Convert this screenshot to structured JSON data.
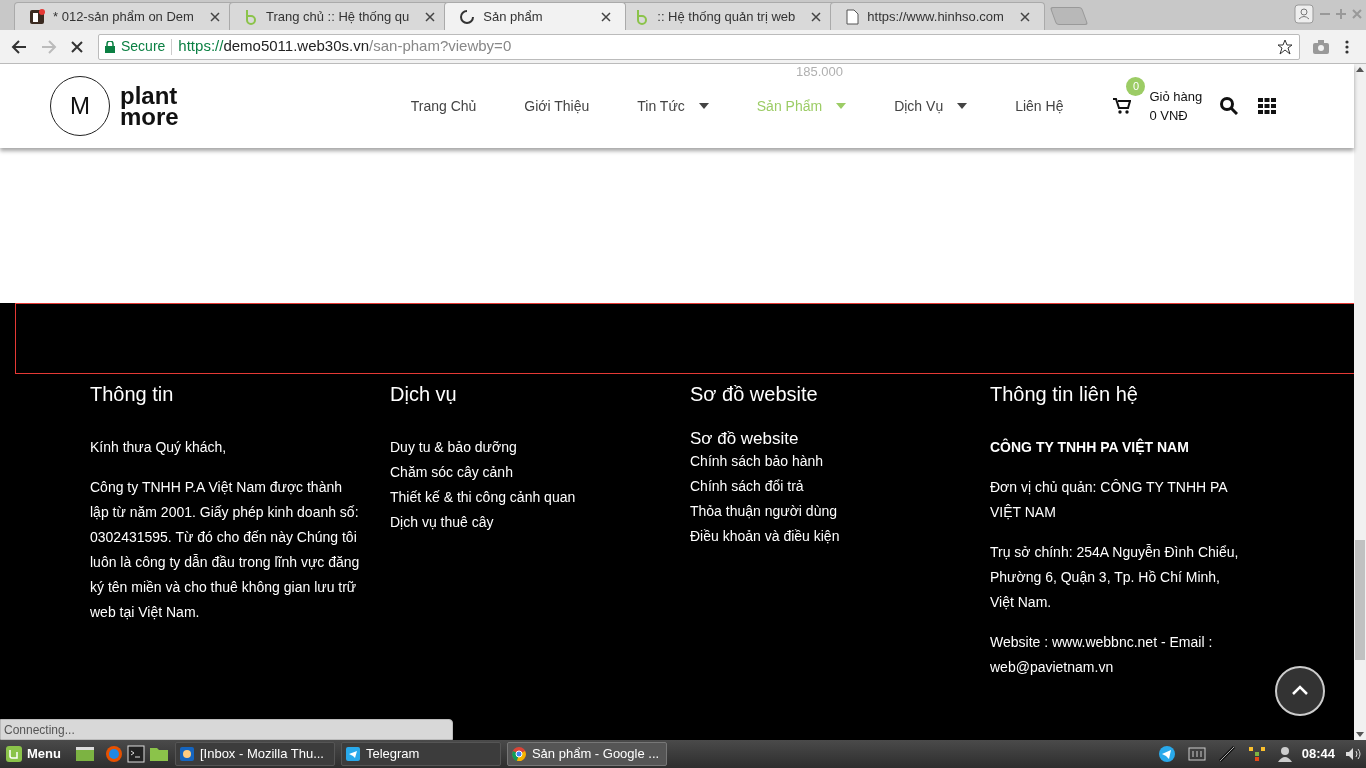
{
  "browser": {
    "tabs": [
      {
        "title": "* 012-sản phẩm on Dem",
        "selected": false
      },
      {
        "title": "Trang chủ :: Hệ thống qu",
        "selected": false
      },
      {
        "title": "Sản phẩm",
        "selected": true
      },
      {
        "title": ":: Hệ thống quản trị web",
        "selected": false
      },
      {
        "title": "https://www.hinhso.com",
        "selected": false
      }
    ],
    "secure_label": "Secure",
    "url_scheme": "https://",
    "url_host": "demo5011.web30s.vn",
    "url_path": "/san-pham?viewby=0"
  },
  "header": {
    "logo_mark": "M",
    "logo_line1": "plant",
    "logo_line2": "more",
    "faded_price": "185.000",
    "nav": [
      {
        "label": "Trang Chủ",
        "selected": false,
        "dropdown": false
      },
      {
        "label": "Giới Thiệu",
        "selected": false,
        "dropdown": false
      },
      {
        "label": "Tin Tức",
        "selected": false,
        "dropdown": true
      },
      {
        "label": "Sản Phẩm",
        "selected": true,
        "dropdown": true
      },
      {
        "label": "Dịch Vụ",
        "selected": false,
        "dropdown": true
      },
      {
        "label": "Liên Hệ",
        "selected": false,
        "dropdown": false
      }
    ],
    "cart_count": "0",
    "cart_label": "Giỏ hàng",
    "cart_total": "0 VNĐ"
  },
  "footer": {
    "columns": [
      {
        "heading": "Thông tin",
        "items": [
          {
            "kind": "para",
            "text": "Kính thưa Quý khách,"
          },
          {
            "kind": "para",
            "text": "Công ty TNHH P.A Việt Nam được thành lập từ năm 2001. Giấy phép kinh doanh số: 0302431595. Từ đó cho đến này Chúng tôi luôn là công ty dẫn đầu trong lĩnh vực đăng ký tên miền và cho thuê không gian lưu trữ web tại Việt Nam."
          }
        ]
      },
      {
        "heading": "Dịch vụ",
        "items": [
          {
            "kind": "link",
            "text": "Duy tu & bảo dưỡng"
          },
          {
            "kind": "link",
            "text": "Chăm sóc cây cảnh"
          },
          {
            "kind": "link",
            "text": "Thiết kế & thi công cảnh quan"
          },
          {
            "kind": "link",
            "text": "Dịch vụ thuê cây"
          }
        ]
      },
      {
        "heading": "Sơ đồ website",
        "items": [
          {
            "kind": "subheading",
            "text": "Sơ đồ website"
          },
          {
            "kind": "link",
            "text": "Chính sách bảo hành"
          },
          {
            "kind": "link",
            "text": "Chính sách đổi trả"
          },
          {
            "kind": "link",
            "text": "Thỏa thuận người dùng"
          },
          {
            "kind": "link",
            "text": "Điều khoản và điều kiện"
          }
        ]
      },
      {
        "heading": "Thông tin liên hệ",
        "items": [
          {
            "kind": "company",
            "text": "CÔNG TY TNHH PA VIỆT NAM"
          },
          {
            "kind": "para",
            "text": "Đơn vị chủ quản: CÔNG TY TNHH PA VIỆT NAM"
          },
          {
            "kind": "para",
            "text": "Trụ sở chính: 254A Nguyễn Đình Chiểu, Phường 6, Quận 3, Tp. Hồ Chí Minh, Việt Nam."
          },
          {
            "kind": "para",
            "text": "Website : www.webbnc.net - Email : web@pavietnam.vn"
          }
        ]
      }
    ]
  },
  "status_text": "Connecting...",
  "taskbar": {
    "menu_label": "Menu",
    "windows": [
      {
        "title": "[Inbox - Mozilla Thu...",
        "selected": false
      },
      {
        "title": "Telegram",
        "selected": false
      },
      {
        "title": "Sản phẩm - Google ...",
        "selected": true
      }
    ],
    "clock": "08:44"
  }
}
